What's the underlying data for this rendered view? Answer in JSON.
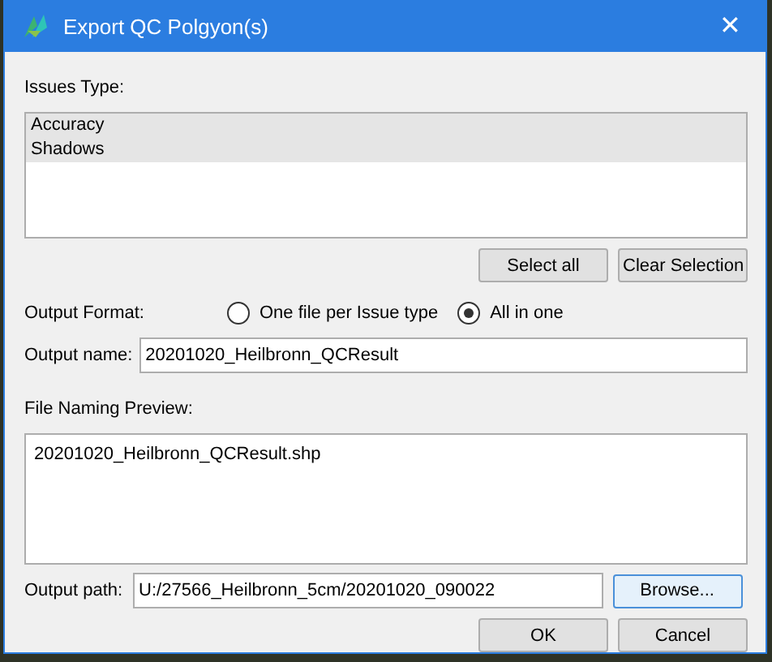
{
  "window": {
    "title": "Export QC Polgyon(s)",
    "close": "✕"
  },
  "issues": {
    "label": "Issues Type:",
    "items": [
      {
        "label": "Accuracy",
        "selected": true
      },
      {
        "label": "Shadows",
        "selected": true
      }
    ]
  },
  "list_buttons": [
    "Select all",
    "Clear Selection"
  ],
  "output_format": {
    "label": "Output Format:",
    "options": [
      {
        "label": "One file per Issue type",
        "selected": false
      },
      {
        "label": "All in one",
        "selected": true
      }
    ]
  },
  "output_name": {
    "label": "Output name:",
    "value": "20201020_Heilbronn_QCResult"
  },
  "preview": {
    "label": "File Naming Preview:",
    "text": "20201020_Heilbronn_QCResult.shp"
  },
  "output_path": {
    "label": "Output path:",
    "value": "U:/27566_Heilbronn_5cm/20201020_090022",
    "button": "Browse..."
  },
  "buttons": [
    "OK",
    "Cancel"
  ]
}
